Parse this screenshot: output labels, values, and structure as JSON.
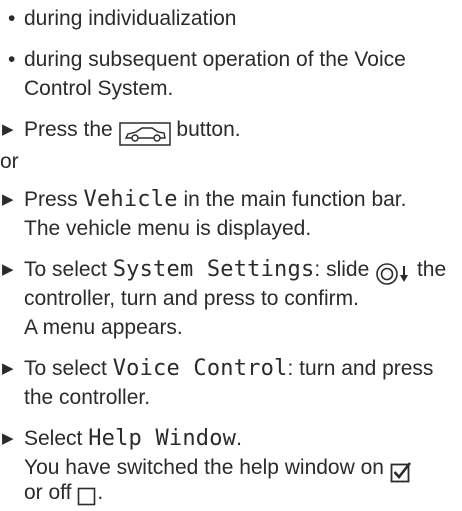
{
  "bullets": [
    {
      "text": "during individualization"
    },
    {
      "line1": "during subsequent operation of the Voice",
      "line2": "Control System."
    }
  ],
  "step_press_car": {
    "before": "Press the",
    "after": "button."
  },
  "or_text": "or",
  "step_vehicle": {
    "before": "Press",
    "code": "Vehicle",
    "after": "in the main function bar.",
    "result": "The vehicle menu is displayed."
  },
  "step_system_settings": {
    "before": "To select",
    "code": "System Settings",
    "middle": ": slide",
    "after": "the",
    "line2": "controller, turn and press to confirm.",
    "line3": "A menu appears."
  },
  "step_voice_control": {
    "before": "To select",
    "code": "Voice Control",
    "after": ": turn and press",
    "line2": "the controller."
  },
  "step_help_window": {
    "before": "Select",
    "code": "Help Window",
    "after": ".",
    "line2_before": "You have switched the help window on",
    "line3_before": "or off",
    "line3_after": "."
  },
  "icons": {
    "bullet": "bullet-dot",
    "step": "triangle-right-arrow",
    "vehicle_button": "car-icon",
    "controller": "controller-slide-down-icon",
    "checkbox_on": "checkbox-checked-icon",
    "checkbox_off": "checkbox-empty-icon"
  }
}
